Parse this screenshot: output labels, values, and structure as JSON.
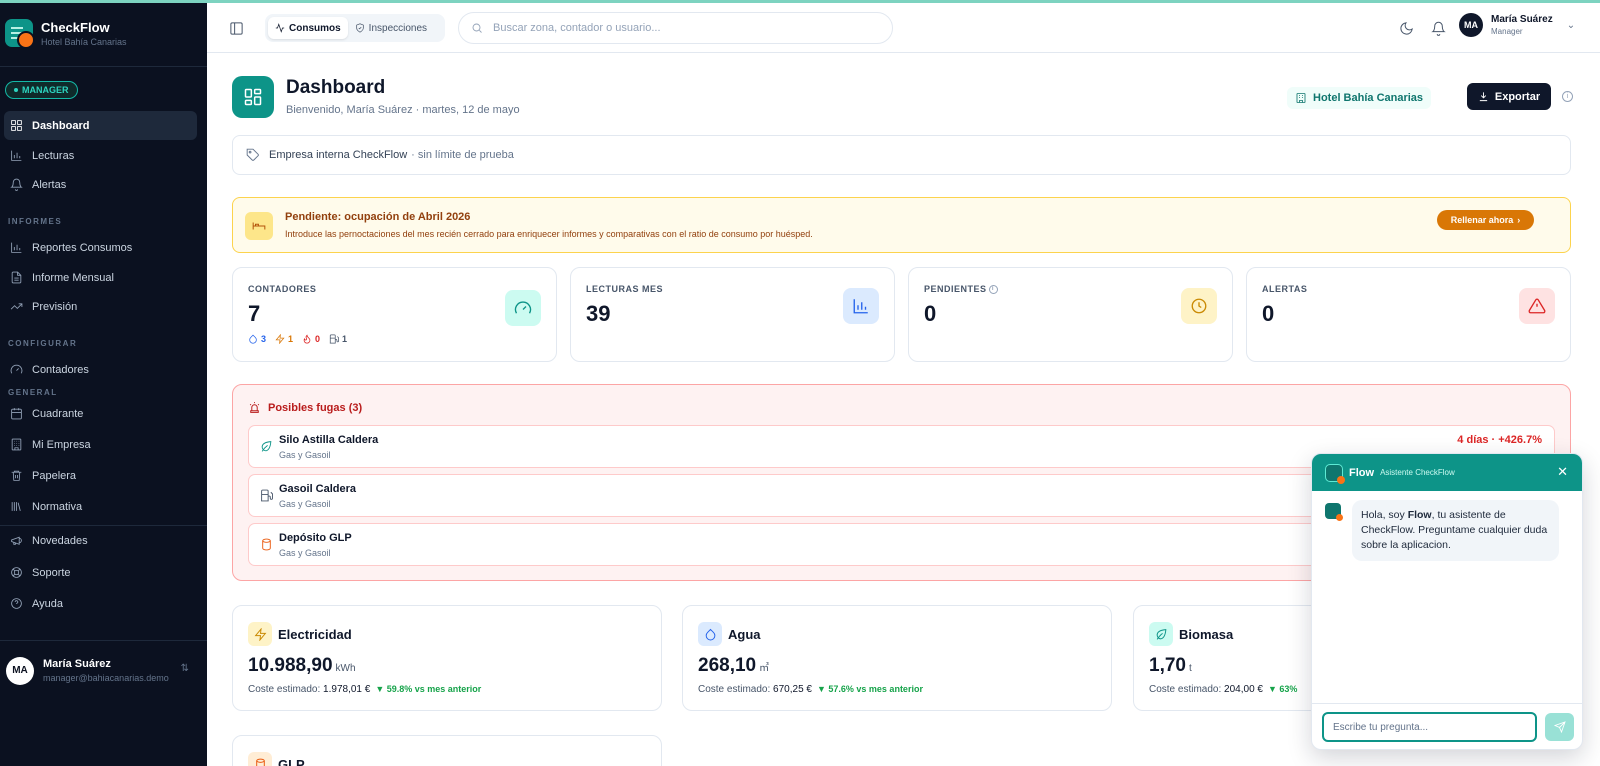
{
  "brand": {
    "name": "CheckFlow",
    "subtitle": "Hotel Bahía Canarias"
  },
  "role_badge": "MANAGER",
  "sidebar": {
    "items": [
      {
        "label": "Dashboard",
        "icon": "layout-grid-icon",
        "active": true
      },
      {
        "label": "Lecturas",
        "icon": "bar-chart-icon"
      },
      {
        "label": "Alertas",
        "icon": "bell-icon"
      }
    ],
    "sections": [
      {
        "title": "INFORMES",
        "items": [
          {
            "label": "Reportes Consumos",
            "icon": "bar-chart-icon"
          },
          {
            "label": "Informe Mensual",
            "icon": "file-text-icon"
          },
          {
            "label": "Previsión",
            "icon": "trending-up-icon"
          }
        ]
      },
      {
        "title": "CONFIGURAR",
        "items": [
          {
            "label": "Contadores",
            "icon": "gauge-icon"
          }
        ]
      },
      {
        "title": "GENERAL",
        "items": [
          {
            "label": "Cuadrante",
            "icon": "calendar-icon"
          },
          {
            "label": "Mi Empresa",
            "icon": "building-icon"
          },
          {
            "label": "Papelera",
            "icon": "trash-icon"
          },
          {
            "label": "Normativa",
            "icon": "library-icon"
          }
        ]
      }
    ],
    "bottom_items": [
      {
        "label": "Novedades",
        "icon": "megaphone-icon"
      },
      {
        "label": "Soporte",
        "icon": "life-buoy-icon"
      },
      {
        "label": "Ayuda",
        "icon": "help-circle-icon"
      }
    ],
    "user": {
      "initials": "MA",
      "name": "María Suárez",
      "email": "manager@bahiacanarias.demo"
    }
  },
  "header": {
    "tabs": [
      {
        "label": "Consumos",
        "icon": "activity-icon",
        "active": true
      },
      {
        "label": "Inspecciones",
        "icon": "shield-check-icon",
        "active": false
      }
    ],
    "search_placeholder": "Buscar zona, contador o usuario...",
    "user": {
      "initials": "MA",
      "name": "María Suárez",
      "role": "Manager"
    }
  },
  "page": {
    "title": "Dashboard",
    "subtitle": "Bienvenido, María Suárez · martes, 12 de mayo",
    "hotel_chip": "Hotel Bahía Canarias",
    "export_label": "Exportar"
  },
  "company_bar": {
    "main": "Empresa interna CheckFlow",
    "muted": "· sin límite de prueba"
  },
  "pending_banner": {
    "title": "Pendiente: ocupación de Abril 2026",
    "text": "Introduce las pernoctaciones del mes recién cerrado para enriquecer informes y comparativas con el ratio de consumo por huésped.",
    "button": "Rellenar ahora"
  },
  "stats": [
    {
      "label": "CONTADORES",
      "value": "7",
      "icon": "gauge-icon",
      "color": "#0d9488",
      "bg": "#ccfbf1",
      "breakdown": [
        {
          "icon": "droplet-icon",
          "value": "3",
          "color": "#2563eb"
        },
        {
          "icon": "zap-icon",
          "value": "1",
          "color": "#d97706"
        },
        {
          "icon": "flame-icon",
          "value": "0",
          "color": "#dc2626"
        },
        {
          "icon": "fuel-icon",
          "value": "1",
          "color": "#475569"
        }
      ]
    },
    {
      "label": "LECTURAS MES",
      "value": "39",
      "icon": "bar-chart-icon",
      "color": "#2563eb",
      "bg": "#dbeafe"
    },
    {
      "label": "PENDIENTES",
      "value": "0",
      "icon": "clock-icon",
      "color": "#ca8a04",
      "bg": "#fef3c7"
    },
    {
      "label": "ALERTAS",
      "value": "0",
      "icon": "alert-triangle-icon",
      "color": "#dc2626",
      "bg": "#fee2e2"
    }
  ],
  "leaks": {
    "title": "Posibles fugas (3)",
    "items": [
      {
        "name": "Silo Astilla Caldera",
        "category": "Gas y Gasoil",
        "trend": "4 días · +426.7%",
        "icon": "leaf-icon",
        "color": "#0d9488"
      },
      {
        "name": "Gasoil Caldera",
        "category": "Gas y Gasoil",
        "trend": "",
        "icon": "fuel-icon",
        "color": "#475569"
      },
      {
        "name": "Depósito GLP",
        "category": "Gas y Gasoil",
        "trend": "",
        "icon": "cylinder-icon",
        "color": "#ea580c"
      }
    ]
  },
  "energy": [
    {
      "name": "Electricidad",
      "value": "10.988,90",
      "unit": "kWh",
      "cost_label": "Coste estimado:",
      "cost": "1.978,01 €",
      "delta": "▼ 59.8% vs mes anterior",
      "icon": "zap-icon",
      "color": "#ca8a04",
      "bg": "#fef3c7"
    },
    {
      "name": "Agua",
      "value": "268,10",
      "unit": "㎥",
      "cost_label": "Coste estimado:",
      "cost": "670,25 €",
      "delta": "▼ 57.6% vs mes anterior",
      "icon": "droplet-icon",
      "color": "#2563eb",
      "bg": "#dbeafe"
    },
    {
      "name": "Biomasa",
      "value": "1,70",
      "unit": "t",
      "cost_label": "Coste estimado:",
      "cost": "204,00 €",
      "delta": "▼ 63%",
      "icon": "leaf-icon",
      "color": "#0d9488",
      "bg": "#ccfbf1"
    },
    {
      "name": "GLP",
      "icon": "cylinder-icon",
      "color": "#ea580c",
      "bg": "#ffedd5"
    }
  ],
  "chat": {
    "title": "Flow",
    "subtitle": "Asistente CheckFlow",
    "message_pre": "Hola, soy ",
    "message_name": "Flow",
    "message_post": ", tu asistente de CheckFlow. Preguntame cualquier duda sobre la aplicacion.",
    "input_placeholder": "Escribe tu pregunta..."
  }
}
